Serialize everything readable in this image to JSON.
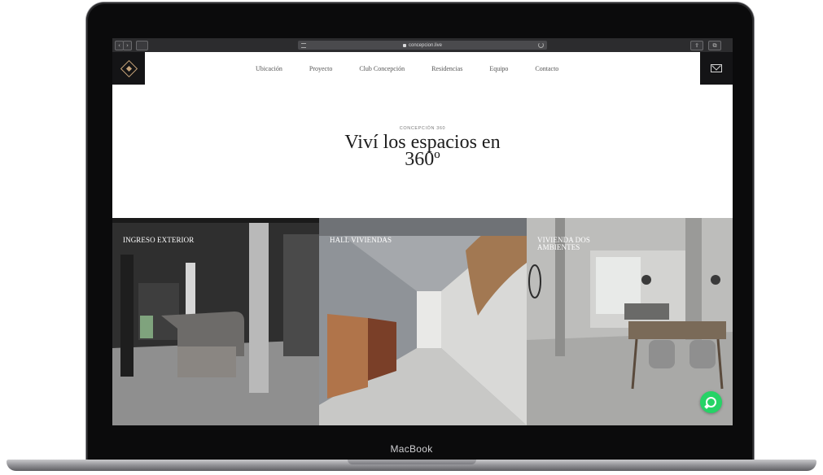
{
  "device": {
    "label": "MacBook"
  },
  "browser": {
    "back_label": "‹",
    "forward_label": "›",
    "address": "concepcion.live",
    "address_placeholder": "",
    "right_buttons": [
      "⇪",
      "⧉"
    ]
  },
  "site": {
    "nav": [
      "Ubicación",
      "Proyecto",
      "Club Concepción",
      "Residencias",
      "Equipo",
      "Contacto"
    ],
    "eyebrow": "CONCEPCIÓN 360",
    "hero_title_line1": "Viví los espacios en",
    "hero_title_line2": "360º",
    "tours": [
      {
        "label": "INGRESO EXTERIOR"
      },
      {
        "label": "HALL VIVIENDAS"
      },
      {
        "label_line1": "VIVIENDA DOS",
        "label_line2": "AMBIENTES"
      }
    ]
  },
  "colors": {
    "brand_dark": "#141416",
    "brand_gold": "#c9a57a",
    "whatsapp": "#25d366"
  }
}
